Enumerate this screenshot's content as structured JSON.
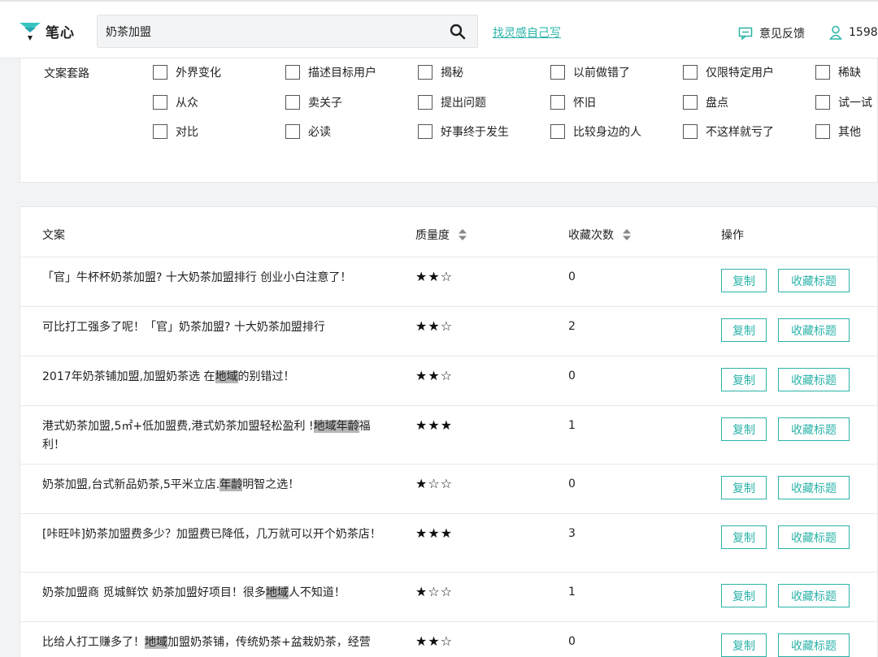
{
  "header": {
    "logo_text": "笔心",
    "search_value": "奶茶加盟",
    "inspire_link": "找灵感自己写",
    "feedback_label": "意见反馈",
    "user_label": "1598"
  },
  "filter": {
    "label": "文案套路",
    "options": [
      [
        "外界变化",
        "描述目标用户",
        "揭秘",
        "以前做错了",
        "仅限特定用户",
        "稀缺"
      ],
      [
        "从众",
        "卖关子",
        "提出问题",
        "怀旧",
        "盘点",
        "试一试"
      ],
      [
        "对比",
        "必读",
        "好事终于发生",
        "比较身边的人",
        "不这样就亏了",
        "其他"
      ]
    ]
  },
  "table": {
    "headers": {
      "copy": "文案",
      "quality": "质量度",
      "favorites": "收藏次数",
      "actions": "操作"
    },
    "copy_button": "复制",
    "favorite_button": "收藏标题",
    "rows": [
      {
        "parts": [
          {
            "t": "「官」牛杯杯奶茶加盟? 十大奶茶加盟排行 创业小白注意了！",
            "h": false
          }
        ],
        "stars": 2,
        "count": "0"
      },
      {
        "parts": [
          {
            "t": "可比打工强多了呢！「官」奶茶加盟? 十大奶茶加盟排行",
            "h": false
          }
        ],
        "stars": 2,
        "count": "2"
      },
      {
        "parts": [
          {
            "t": "2017年奶茶铺加盟,加盟奶茶选 在",
            "h": false
          },
          {
            "t": "地域",
            "h": true
          },
          {
            "t": "的别错过！",
            "h": false
          }
        ],
        "stars": 2,
        "count": "0"
      },
      {
        "parts": [
          {
            "t": "港式奶茶加盟,5㎡+低加盟费,港式奶茶加盟轻松盈利 !",
            "h": false
          },
          {
            "t": "地域年龄",
            "h": true
          },
          {
            "t": "福利！",
            "h": false
          }
        ],
        "stars": 3,
        "count": "1"
      },
      {
        "parts": [
          {
            "t": "奶茶加盟,台式新品奶茶,5平米立店.",
            "h": false
          },
          {
            "t": "年龄",
            "h": true
          },
          {
            "t": "明智之选！",
            "h": false
          }
        ],
        "stars": 1,
        "count": "0"
      },
      {
        "parts": [
          {
            "t": "[咔旺咔]奶茶加盟费多少？加盟费已降低，几万就可以开个奶茶店！",
            "h": false
          }
        ],
        "stars": 3,
        "count": "3"
      },
      {
        "parts": [
          {
            "t": "奶茶加盟商 觅城鲜饮 奶茶加盟好项目！很多",
            "h": false
          },
          {
            "t": "地域",
            "h": true
          },
          {
            "t": "人不知道！",
            "h": false
          }
        ],
        "stars": 1,
        "count": "1"
      },
      {
        "parts": [
          {
            "t": "比给人打工赚多了！",
            "h": false
          },
          {
            "t": "地域",
            "h": true
          },
          {
            "t": "加盟奶茶铺，传统奶茶+盆栽奶茶，经营",
            "h": false
          }
        ],
        "stars": 2,
        "count": "0"
      }
    ]
  },
  "colors": {
    "accent": "#2bb3a8",
    "highlight": "#b5b5b5"
  }
}
